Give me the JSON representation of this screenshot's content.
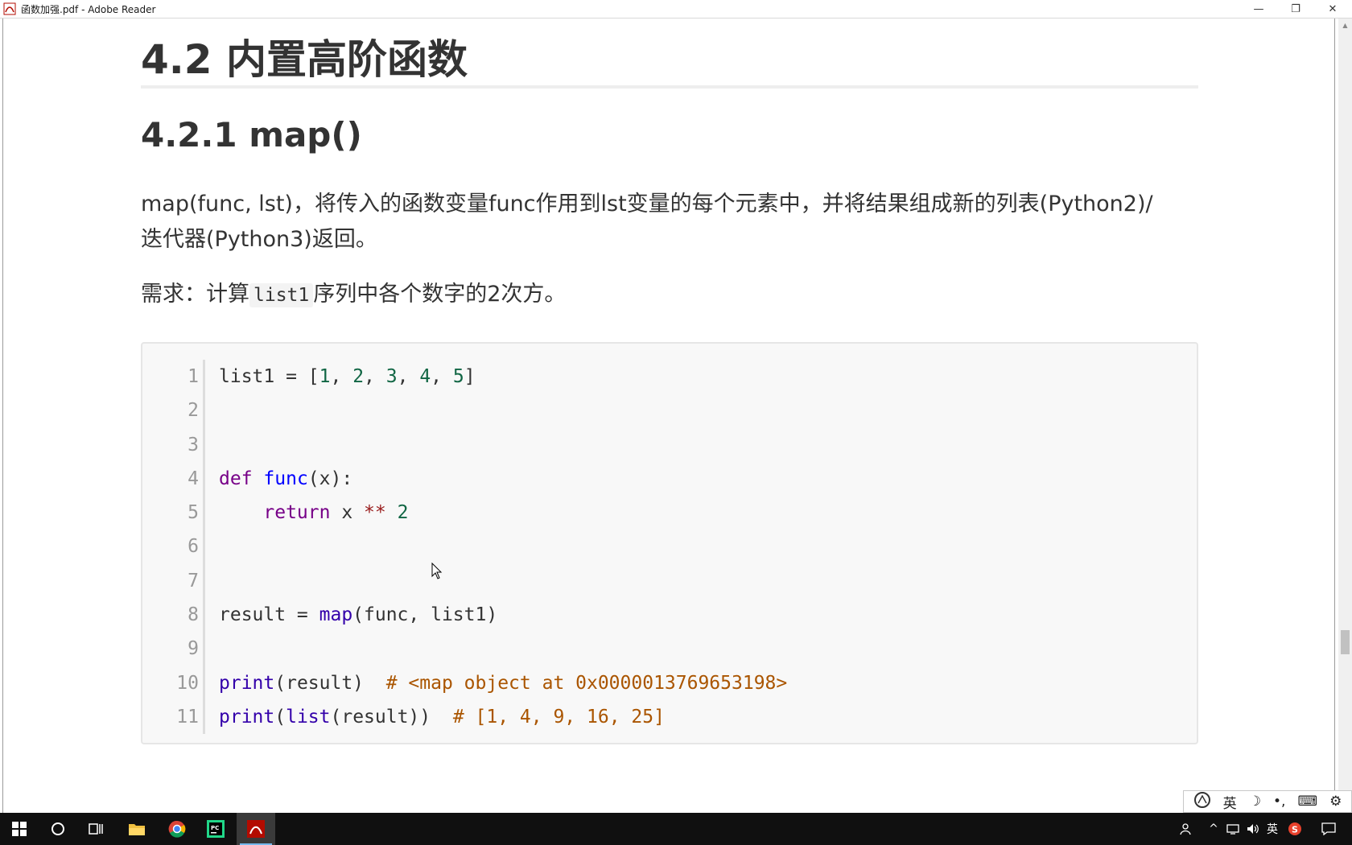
{
  "window": {
    "title": "函数加强.pdf - Adobe Reader",
    "minimize_label": "—",
    "maximize_label": "❐",
    "close_label": "✕"
  },
  "document": {
    "heading_main": "4.2 内置高阶函数",
    "heading_sub": "4.2.1 map()",
    "paragraph1_line1": "map(func, lst)，将传入的函数变量func作用到lst变量的每个元素中，并将结果组成新的列表(Python2)/",
    "paragraph1_line2": "迭代器(Python3)返回。",
    "paragraph2_prefix": "需求：计算",
    "paragraph2_code": "list1",
    "paragraph2_suffix": "序列中各个数字的2次方。",
    "code_lines": [
      {
        "n": "1"
      },
      {
        "n": "2"
      },
      {
        "n": "3"
      },
      {
        "n": "4"
      },
      {
        "n": "5"
      },
      {
        "n": "6"
      },
      {
        "n": "7"
      },
      {
        "n": "8"
      },
      {
        "n": "9"
      },
      {
        "n": "10"
      },
      {
        "n": "11"
      }
    ],
    "code": {
      "l1_a": "list1 = [",
      "l1_n1": "1",
      "l1_n2": "2",
      "l1_n3": "3",
      "l1_n4": "4",
      "l1_n5": "5",
      "l4_def": "def",
      "l4_name": "func",
      "l4_rest": "(x):",
      "l5_ret": "return",
      "l5_x": " x ",
      "l5_op": "**",
      "l5_num": "2",
      "l8_a": "result = ",
      "l8_map": "map",
      "l8_rest": "(func, list1)",
      "l10_print": "print",
      "l10_rest": "(result)  ",
      "l10_comment": "# <map object at 0x0000013769653198>",
      "l11_print": "print",
      "l11_p": "(",
      "l11_list": "list",
      "l11_rest": "(result))  ",
      "l11_comment": "# [1, 4, 9, 16, 25]"
    }
  },
  "ime": {
    "lang": "英",
    "items": [
      "英",
      "☽",
      "•,",
      "⌨",
      "⚙"
    ]
  },
  "taskbar": {
    "tray_lang": "英",
    "icons": [
      "windows-start-icon",
      "search-icon",
      "task-view-icon",
      "file-explorer-icon",
      "chrome-icon",
      "pycharm-icon",
      "adobe-reader-icon"
    ]
  },
  "colors": {
    "keyword": "#770088",
    "function_def": "#0000ff",
    "number": "#116644",
    "operator": "#981a1a",
    "builtin": "#3300aa",
    "comment": "#aa5500",
    "taskbar": "#101010"
  }
}
